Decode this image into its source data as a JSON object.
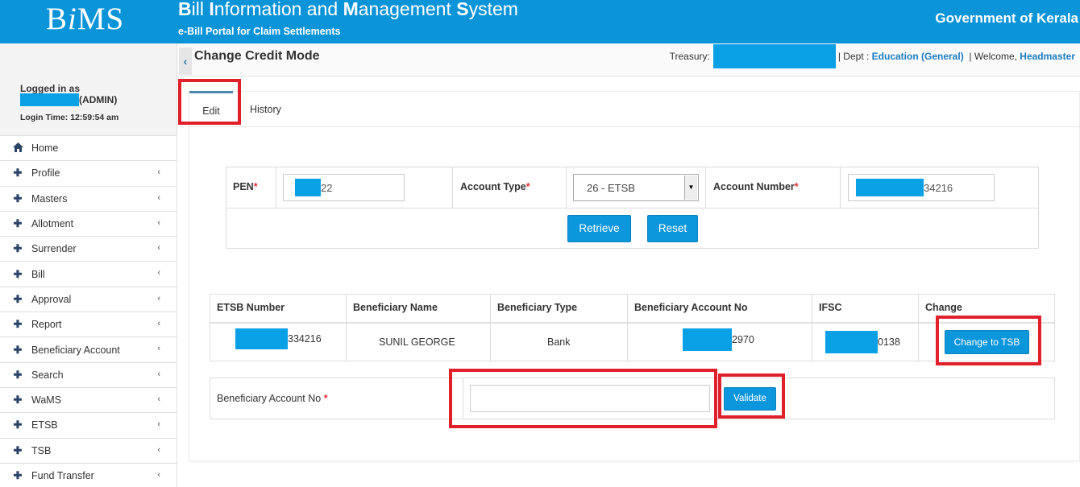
{
  "header": {
    "logo_pre": "B",
    "logo_i": "i",
    "logo_post": "MS",
    "title_parts": [
      {
        "b": "B",
        "t": "ill "
      },
      {
        "b": "I",
        "t": "nformation and "
      },
      {
        "b": "M",
        "t": "anagement "
      },
      {
        "b": "S",
        "t": "ystem"
      }
    ],
    "subtitle": "e-Bill Portal for Claim Settlements",
    "government": "Government of Kerala"
  },
  "user": {
    "logged_in_as": "Logged in as",
    "role": "(ADMIN)",
    "login_time": "Login Time: 12:59:54 am"
  },
  "sidebar": {
    "items": [
      {
        "label": "Home",
        "icon": "home-icon",
        "has_chevron": false
      },
      {
        "label": "Profile",
        "icon": "plus-icon",
        "has_chevron": true
      },
      {
        "label": "Masters",
        "icon": "plus-icon",
        "has_chevron": true
      },
      {
        "label": "Allotment",
        "icon": "plus-icon",
        "has_chevron": true
      },
      {
        "label": "Surrender",
        "icon": "plus-icon",
        "has_chevron": true
      },
      {
        "label": "Bill",
        "icon": "plus-icon",
        "has_chevron": true
      },
      {
        "label": "Approval",
        "icon": "plus-icon",
        "has_chevron": true
      },
      {
        "label": "Report",
        "icon": "plus-icon",
        "has_chevron": true
      },
      {
        "label": "Beneficiary Account",
        "icon": "plus-icon",
        "has_chevron": true
      },
      {
        "label": "Search",
        "icon": "plus-icon",
        "has_chevron": true
      },
      {
        "label": "WaMS",
        "icon": "plus-icon",
        "has_chevron": true
      },
      {
        "label": "ETSB",
        "icon": "plus-icon",
        "has_chevron": true
      },
      {
        "label": "TSB",
        "icon": "plus-icon",
        "has_chevron": true
      },
      {
        "label": "Fund Transfer",
        "icon": "plus-icon",
        "has_chevron": true
      }
    ]
  },
  "page": {
    "title": "Change Credit Mode",
    "treasury_label": "Treasury:",
    "dept_label": "| Dept :",
    "dept_value": "Education (General)",
    "welcome_label": "| Welcome,",
    "welcome_user": "Headmaster"
  },
  "tabs": {
    "edit": "Edit",
    "history": "History"
  },
  "form": {
    "pen_label": "PEN",
    "pen_value_suffix": "22",
    "account_type_label": "Account Type",
    "account_type_value": "26 - ETSB",
    "account_number_label": "Account Number",
    "account_number_suffix": "34216",
    "required_mark": "*",
    "retrieve_label": "Retrieve",
    "reset_label": "Reset"
  },
  "result_table": {
    "headers": [
      "ETSB Number",
      "Beneficiary Name",
      "Beneficiary Type",
      "Beneficiary Account No",
      "IFSC",
      "Change"
    ],
    "row": {
      "etsb_number_suffix": "334216",
      "beneficiary_name": "SUNIL GEORGE",
      "beneficiary_type": "Bank",
      "beneficiary_account_suffix": "2970",
      "ifsc_suffix": "0138",
      "change_button": "Change to TSB"
    }
  },
  "beneficiary": {
    "label": "Beneficiary Account No",
    "required_mark": "*",
    "input_value": "",
    "validate_label": "Validate"
  },
  "colors": {
    "header_bg": "#0c94d8",
    "button_bg": "#0c96dc",
    "highlight_red": "#e0202a",
    "redaction_blue": "#0aa0e6"
  }
}
